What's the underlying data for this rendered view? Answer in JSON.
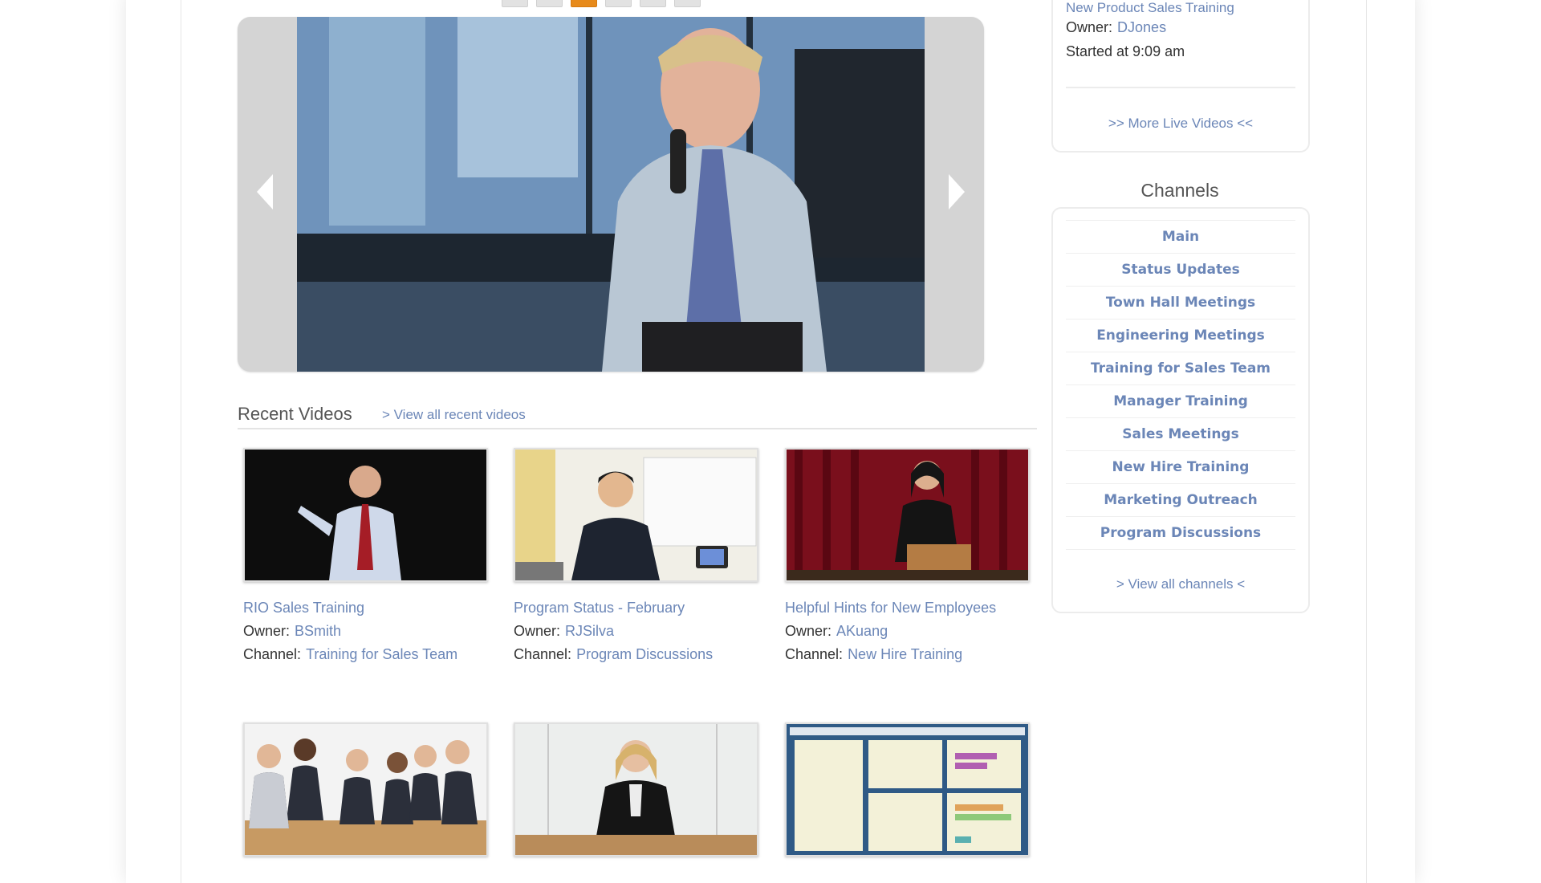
{
  "carousel": {
    "prev_label": "previous slide",
    "next_label": "next slide",
    "dot_count": 6,
    "active_dot": 3
  },
  "recent": {
    "title": "Recent Videos",
    "view_all": "> View all recent videos",
    "videos": [
      {
        "title": "RIO Sales Training",
        "owner_label": "Owner:",
        "owner": "BSmith",
        "channel_label": "Channel:",
        "channel": "Training for Sales Team"
      },
      {
        "title": "Program Status - February",
        "owner_label": "Owner:",
        "owner": "RJSilva",
        "channel_label": "Channel:",
        "channel": "Program Discussions"
      },
      {
        "title": "Helpful Hints for New Employees",
        "owner_label": "Owner:",
        "owner": "AKuang",
        "channel_label": "Channel:",
        "channel": "New Hire Training"
      }
    ]
  },
  "live": {
    "title": "New Product Sales Training",
    "owner_label": "Owner:",
    "owner": "DJones",
    "started": "Started at 9:09 am",
    "more": ">> More Live Videos <<"
  },
  "channels": {
    "heading": "Channels",
    "items": [
      "Main",
      "Status Updates",
      "Town Hall Meetings",
      "Engineering Meetings",
      "Training for Sales Team",
      "Manager Training",
      "Sales Meetings",
      "New Hire Training",
      "Marketing Outreach",
      "Program Discussions"
    ],
    "view_all": "> View all channels <"
  },
  "colors": {
    "link": "#6b86b7",
    "active_dot": "#e78a1b"
  }
}
